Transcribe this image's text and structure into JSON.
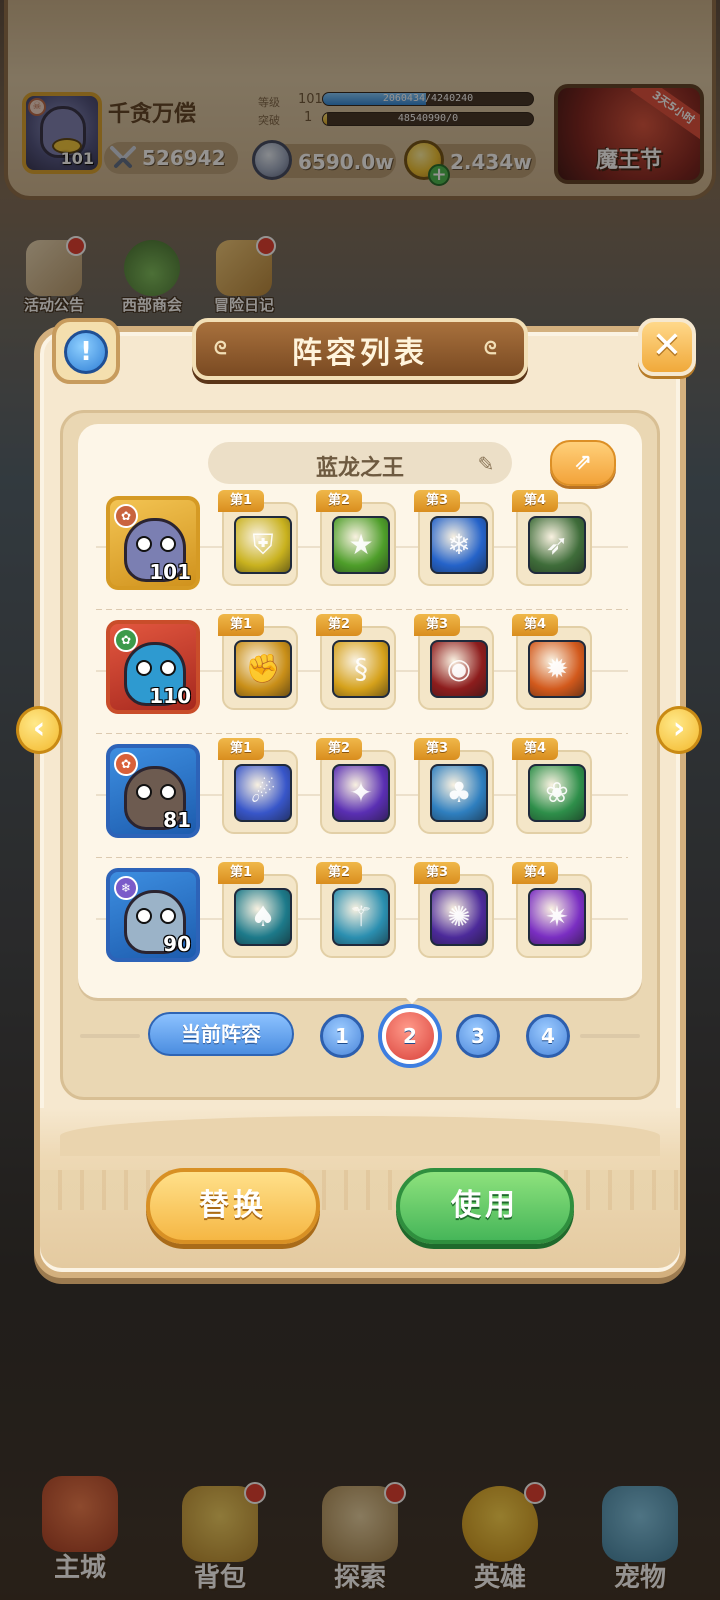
{
  "player": {
    "name": "千贪万偿",
    "avatar_level": "101",
    "power": "526942",
    "level_label": "等级",
    "level_value": "101",
    "exp_text": "2060434/4240240",
    "exp_fraction": 0.49,
    "breakthrough_label": "突破",
    "breakthrough_value": "1",
    "breakthrough_text": "48540990/0",
    "breakthrough_fraction": 0.02
  },
  "currencies": {
    "diamond": "6590.0w",
    "gold": "2.434w"
  },
  "event": {
    "title": "魔王节",
    "ribbon": "3天5小时"
  },
  "shortcuts": [
    {
      "label": "活动公告"
    },
    {
      "label": "西部商会"
    },
    {
      "label": "冒险日记"
    }
  ],
  "modal": {
    "title": "阵容列表",
    "lineup_name": "蓝龙之王",
    "close_glyph": "✕",
    "info_glyph": "!"
  },
  "heroes": [
    {
      "level": "101",
      "colors": [
        "#f3c453",
        "#d0921d",
        "#7b7fb2"
      ],
      "skills": [
        {
          "tag": "第1",
          "icon": "golden-shield-icon",
          "glyph": "⛨",
          "bg": "#c9b21f"
        },
        {
          "tag": "第2",
          "icon": "star-shield-icon",
          "glyph": "★",
          "bg": "#4e9e2a"
        },
        {
          "tag": "第3",
          "icon": "ice-slash-icon",
          "glyph": "❄",
          "bg": "#2563c9"
        },
        {
          "tag": "第4",
          "icon": "arrow-strike-icon",
          "glyph": "➶",
          "bg": "#3f6d3a"
        }
      ]
    },
    {
      "level": "110",
      "colors": [
        "#e2573f",
        "#a6281e",
        "#2e9ad0"
      ],
      "skills": [
        {
          "tag": "第1",
          "icon": "pig-charge-icon",
          "glyph": "✊",
          "bg": "#c98f18"
        },
        {
          "tag": "第2",
          "icon": "golden-serpent-icon",
          "glyph": "§",
          "bg": "#d5a11b"
        },
        {
          "tag": "第3",
          "icon": "dragon-eye-icon",
          "glyph": "◉",
          "bg": "#8d1d1d"
        },
        {
          "tag": "第4",
          "icon": "fire-dragon-icon",
          "glyph": "✹",
          "bg": "#d2591c"
        }
      ]
    },
    {
      "level": "81",
      "colors": [
        "#3d8ee0",
        "#1d5cae",
        "#6d5b50"
      ],
      "skills": [
        {
          "tag": "第1",
          "icon": "comet-rain-icon",
          "glyph": "☄",
          "bg": "#3856c9"
        },
        {
          "tag": "第2",
          "icon": "arcane-rain-icon",
          "glyph": "✦",
          "bg": "#5a2fb3"
        },
        {
          "tag": "第3",
          "icon": "tree-guardian-icon",
          "glyph": "♣",
          "bg": "#2f7fbf"
        },
        {
          "tag": "第4",
          "icon": "blossom-heal-icon",
          "glyph": "❀",
          "bg": "#2e8f4a"
        }
      ]
    },
    {
      "level": "90",
      "colors": [
        "#3d8ee0",
        "#1d5cae",
        "#9bb3c8"
      ],
      "skills": [
        {
          "tag": "第1",
          "icon": "red-mask-icon",
          "glyph": "♠",
          "bg": "#1d7a8a"
        },
        {
          "tag": "第2",
          "icon": "frost-staff-icon",
          "glyph": "⚚",
          "bg": "#2b8fb0"
        },
        {
          "tag": "第3",
          "icon": "void-vortex-icon",
          "glyph": "✺",
          "bg": "#4c2a9a"
        },
        {
          "tag": "第4",
          "icon": "purple-burst-icon",
          "glyph": "✷",
          "bg": "#7a2ec2"
        }
      ]
    }
  ],
  "switcher": {
    "current_label": "当前阵容",
    "slots": [
      "1",
      "2",
      "3",
      "4"
    ],
    "active_slot": "2"
  },
  "actions": {
    "replace_label": "替换",
    "use_label": "使用"
  },
  "nav": {
    "city": "主城",
    "bag": "背包",
    "explore": "探索",
    "heroes": "英雄",
    "pets": "宠物"
  },
  "colors": {
    "accent_blue": "#4b8de0",
    "accent_gold": "#f3a33a",
    "accent_green": "#46b659",
    "panel_cream": "#f6e8cf"
  }
}
